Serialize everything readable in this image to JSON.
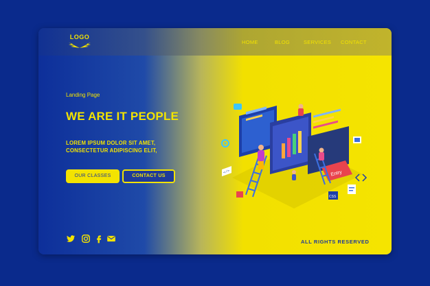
{
  "header": {
    "logo_text": "LOGO",
    "nav": [
      "HOME",
      "BLOG",
      "SERVICES",
      "CONTACT"
    ]
  },
  "hero": {
    "subtitle": "Landing Page",
    "title": "WE ARE IT PEOPLE",
    "body_line1": "LOREM IPSUM DOLOR SIT AMET,",
    "body_line2": "CONSECTETUR ADIPISCING ELIT,",
    "primary_button": "OUR CLASSES",
    "secondary_button": "CONTACT US"
  },
  "illustration": {
    "board_label": "Entry",
    "css_label": "CSS"
  },
  "footer": {
    "social_icons": [
      "twitter-icon",
      "instagram-icon",
      "facebook-icon",
      "mail-icon"
    ],
    "rights": "ALL RIGHTS RESERVED"
  },
  "colors": {
    "brand_blue": "#0d2f9a",
    "brand_yellow": "#f3e300"
  }
}
